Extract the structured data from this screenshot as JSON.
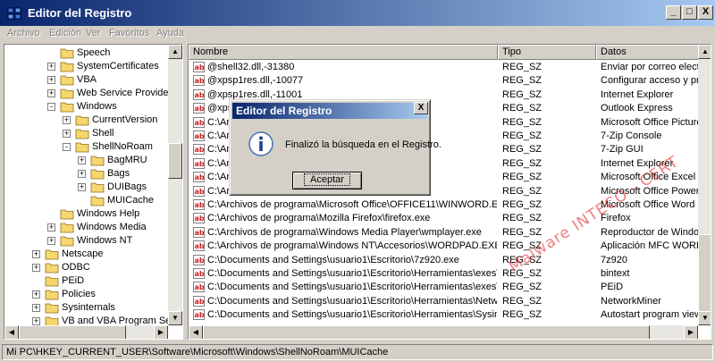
{
  "window": {
    "title": "Editor del Registro",
    "controls": {
      "minimize": "_",
      "maximize": "□",
      "close": "X"
    }
  },
  "menu": [
    "Archivo",
    "Edición",
    "Ver",
    "Favoritos",
    "Ayuda"
  ],
  "tree": {
    "items": [
      {
        "label": "Speech",
        "expander": "",
        "level": 2
      },
      {
        "label": "SystemCertificates",
        "expander": "+",
        "level": 2
      },
      {
        "label": "VBA",
        "expander": "+",
        "level": 2
      },
      {
        "label": "Web Service Providers",
        "expander": "+",
        "level": 2
      },
      {
        "label": "Windows",
        "expander": "-",
        "level": 2
      },
      {
        "label": "CurrentVersion",
        "expander": "+",
        "level": 3
      },
      {
        "label": "Shell",
        "expander": "+",
        "level": 3
      },
      {
        "label": "ShellNoRoam",
        "expander": "-",
        "level": 3
      },
      {
        "label": "BagMRU",
        "expander": "+",
        "level": 4
      },
      {
        "label": "Bags",
        "expander": "+",
        "level": 4
      },
      {
        "label": "DUIBags",
        "expander": "+",
        "level": 4
      },
      {
        "label": "MUICache",
        "expander": "",
        "level": 4
      },
      {
        "label": "Windows Help",
        "expander": "",
        "level": 2
      },
      {
        "label": "Windows Media",
        "expander": "+",
        "level": 2
      },
      {
        "label": "Windows NT",
        "expander": "+",
        "level": 2
      },
      {
        "label": "Netscape",
        "expander": "+",
        "level": 1
      },
      {
        "label": "ODBC",
        "expander": "+",
        "level": 1
      },
      {
        "label": "PEiD",
        "expander": "",
        "level": 1
      },
      {
        "label": "Policies",
        "expander": "+",
        "level": 1
      },
      {
        "label": "Sysinternals",
        "expander": "+",
        "level": 1
      },
      {
        "label": "VB and VBA Program Settings",
        "expander": "+",
        "level": 1
      }
    ]
  },
  "list": {
    "columns": [
      "Nombre",
      "Tipo",
      "Datos"
    ],
    "rows": [
      {
        "name": "@shell32.dll,-31380",
        "type": "REG_SZ",
        "data": "Enviar por correo electrónico"
      },
      {
        "name": "@xpsp1res.dll,-10077",
        "type": "REG_SZ",
        "data": "Configurar acceso y programas"
      },
      {
        "name": "@xpsp1res.dll,-11001",
        "type": "REG_SZ",
        "data": "Internet Explorer"
      },
      {
        "name": "@xpsp",
        "type": "REG_SZ",
        "data": "Outlook Express"
      },
      {
        "name": "C:\\Ar",
        "type": "REG_SZ",
        "data": "Microsoft Office Picture Manager"
      },
      {
        "name": "C:\\Arc",
        "type": "REG_SZ",
        "data": "7-Zip Console"
      },
      {
        "name": "C:\\Arc",
        "type": "REG_SZ",
        "data": "7-Zip GUI"
      },
      {
        "name": "C:\\Arc",
        "type": "REG_SZ",
        "data": "Internet Explorer"
      },
      {
        "name": "C:\\Arc                                                                          EL.EXE",
        "type": "REG_SZ",
        "data": "Microsoft Office Excel"
      },
      {
        "name": "C:\\Arc                                                                          WERPNT.EXE",
        "type": "REG_SZ",
        "data": "Microsoft Office PowerPoint"
      },
      {
        "name": "C:\\Archivos de programa\\Microsoft Office\\OFFICE11\\WINWORD.EXE",
        "type": "REG_SZ",
        "data": "Microsoft Office Word"
      },
      {
        "name": "C:\\Archivos de programa\\Mozilla Firefox\\firefox.exe",
        "type": "REG_SZ",
        "data": "Firefox"
      },
      {
        "name": "C:\\Archivos de programa\\Windows Media Player\\wmplayer.exe",
        "type": "REG_SZ",
        "data": "Reproductor de Windows Media"
      },
      {
        "name": "C:\\Archivos de programa\\Windows NT\\Accesorios\\WORDPAD.EXE",
        "type": "REG_SZ",
        "data": "Aplicación MFC WORDPAD"
      },
      {
        "name": "C:\\Documents and Settings\\usuario1\\Escritorio\\7z920.exe",
        "type": "REG_SZ",
        "data": "7z920"
      },
      {
        "name": "C:\\Documents and Settings\\usuario1\\Escritorio\\Herramientas\\exes\\Bin...",
        "type": "REG_SZ",
        "data": "bintext"
      },
      {
        "name": "C:\\Documents and Settings\\usuario1\\Escritorio\\Herramientas\\exes\\PEi...",
        "type": "REG_SZ",
        "data": "PEiD"
      },
      {
        "name": "C:\\Documents and Settings\\usuario1\\Escritorio\\Herramientas\\Network...",
        "type": "REG_SZ",
        "data": "NetworkMiner"
      },
      {
        "name": "C:\\Documents and Settings\\usuario1\\Escritorio\\Herramientas\\Sysinter...",
        "type": "REG_SZ",
        "data": "Autostart program viewer"
      }
    ]
  },
  "status": {
    "path": "Mi PC\\HKEY_CURRENT_USER\\Software\\Microsoft\\Windows\\ShellNoRoam\\MUICache"
  },
  "dialog": {
    "title": "Editor del Registro",
    "close": "X",
    "message": "Finalizó la búsqueda en el Registro.",
    "ok_label": "Aceptar"
  },
  "watermark": {
    "text": "Malware INTECO - CERT"
  },
  "colors": {
    "title_start": "#08246b",
    "title_end": "#a6caf0",
    "folder": "#f5d76e",
    "string_icon": "#cc2222"
  }
}
